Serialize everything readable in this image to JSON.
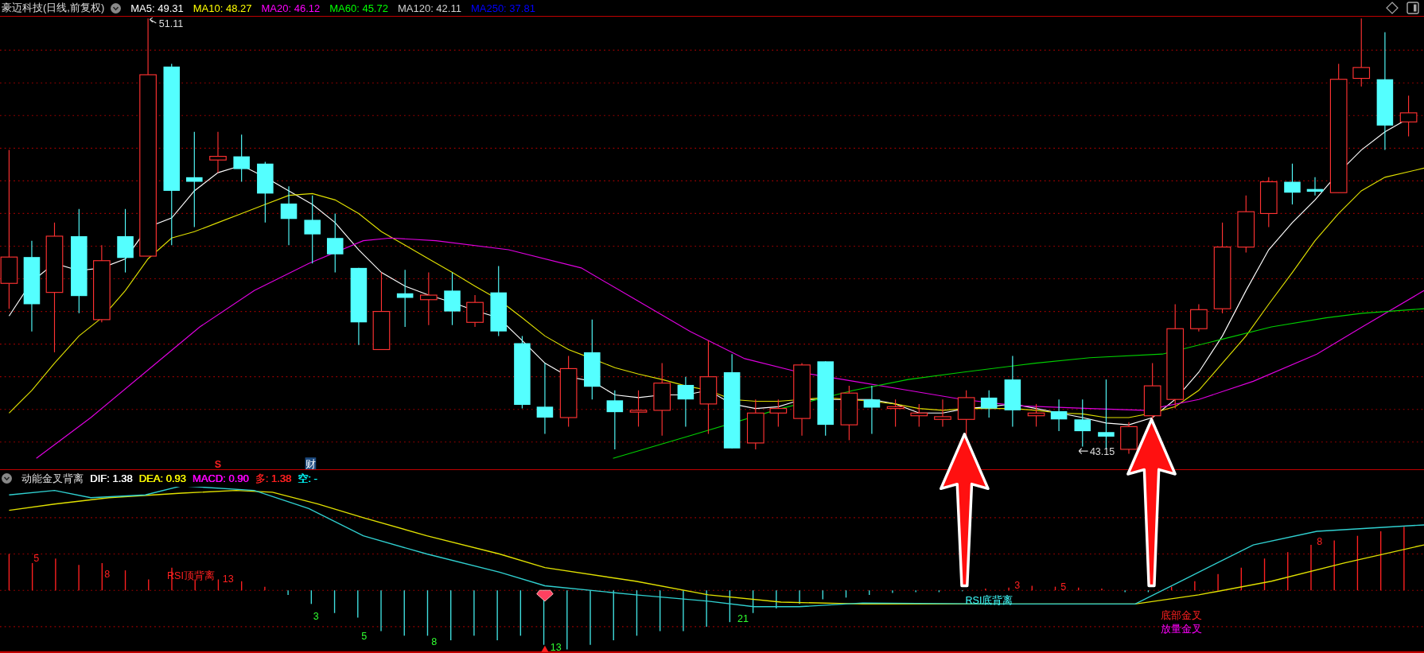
{
  "header": {
    "title": "豪迈科技(日线,前复权)",
    "ma_legend": [
      {
        "label": "MA5: 49.31",
        "color": "#ffffff"
      },
      {
        "label": "MA10: 48.27",
        "color": "#ffff00"
      },
      {
        "label": "MA20: 46.12",
        "color": "#ff00ff"
      },
      {
        "label": "MA60: 45.72",
        "color": "#00ff00"
      },
      {
        "label": "MA120: 42.11",
        "color": "#d0d0d0"
      },
      {
        "label": "MA250: 37.81",
        "color": "#0000ff"
      }
    ]
  },
  "price_chart": {
    "high_marker": "51.11",
    "low_marker": "43.15",
    "event_markers": [
      {
        "kind": "sell",
        "text": "S"
      },
      {
        "kind": "finance",
        "text": "财"
      }
    ]
  },
  "indicator": {
    "title": "动能金叉背离",
    "legend": [
      {
        "label": "DIF: 1.38",
        "color": "#ffffff"
      },
      {
        "label": "DEA: 0.93",
        "color": "#ffff00"
      },
      {
        "label": "MACD: 0.90",
        "color": "#ff00ff"
      },
      {
        "label": "多: 1.38",
        "color": "#ff2020"
      },
      {
        "label": "空: -",
        "color": "#00ffff"
      }
    ],
    "signal_labels": [
      {
        "text": "5",
        "color": "#ff2020"
      },
      {
        "text": "8",
        "color": "#ff2020"
      },
      {
        "text": "RSI顶背离",
        "color": "#ff2020"
      },
      {
        "text": "13",
        "color": "#ff2020"
      },
      {
        "text": "3",
        "color": "#30ff30"
      },
      {
        "text": "5",
        "color": "#30ff30"
      },
      {
        "text": "8",
        "color": "#30ff30"
      },
      {
        "text": "13",
        "color": "#30ff30"
      },
      {
        "text": "21",
        "color": "#30ff30"
      },
      {
        "text": "RSI底背离",
        "color": "#40ffff"
      },
      {
        "text": "3",
        "color": "#ff2020"
      },
      {
        "text": "5",
        "color": "#ff2020"
      },
      {
        "text": "底部金叉",
        "color": "#ff2020"
      },
      {
        "text": "放量金叉",
        "color": "#ff00ff"
      },
      {
        "text": "8",
        "color": "#ff2020"
      }
    ]
  }
}
